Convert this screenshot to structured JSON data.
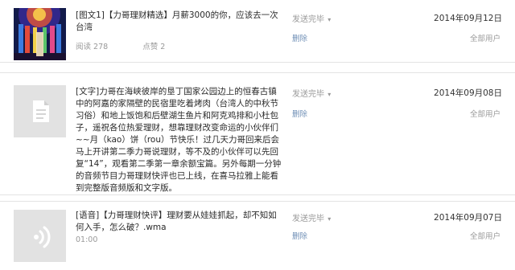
{
  "messages": [
    {
      "text": "[图文1]【力哥理财精选】月薪3000的你，应该去一次台湾",
      "reads": "阅读 278",
      "likes": "点赞 2",
      "status": "发送完毕",
      "delete_label": "删除",
      "date": "2014年09月12日",
      "audience": "全部用户",
      "thumb_icon": "photo-thumbnail"
    },
    {
      "text": "[文字]力哥在海峡彼岸的垦丁国家公园边上的恒春古镇中的阿嘉的家隔壁的民宿里吃着烤肉（台湾人的中秋节习俗）和地上饭饱和后壁湖生鱼片和阿克鸡排和小杜包子，遥祝各位热爱理财，想靠理财改变命运的小伙伴们~~月（kao）饼（rou）节快乐！过几天力哥回来后会马上开讲第二季力哥说理财，等不及的小伙伴可以先回复“14”，观看第二季第一章余额宝篇。另外每期一分钟的音频节目力哥理财快评也已上线，在喜马拉雅上能看到完整版音频版和文字版。",
      "status": "发送完毕",
      "delete_label": "删除",
      "date": "2014年09月08日",
      "audience": "全部用户",
      "thumb_icon": "document-icon"
    },
    {
      "text": "[语音]【力哥理财快评】理财要从娃娃抓起，却不知如何入手，怎么破？.wma",
      "duration": "01:00",
      "status": "发送完毕",
      "delete_label": "删除",
      "date": "2014年09月07日",
      "audience": "全部用户",
      "thumb_icon": "audio-wave-icon"
    }
  ]
}
